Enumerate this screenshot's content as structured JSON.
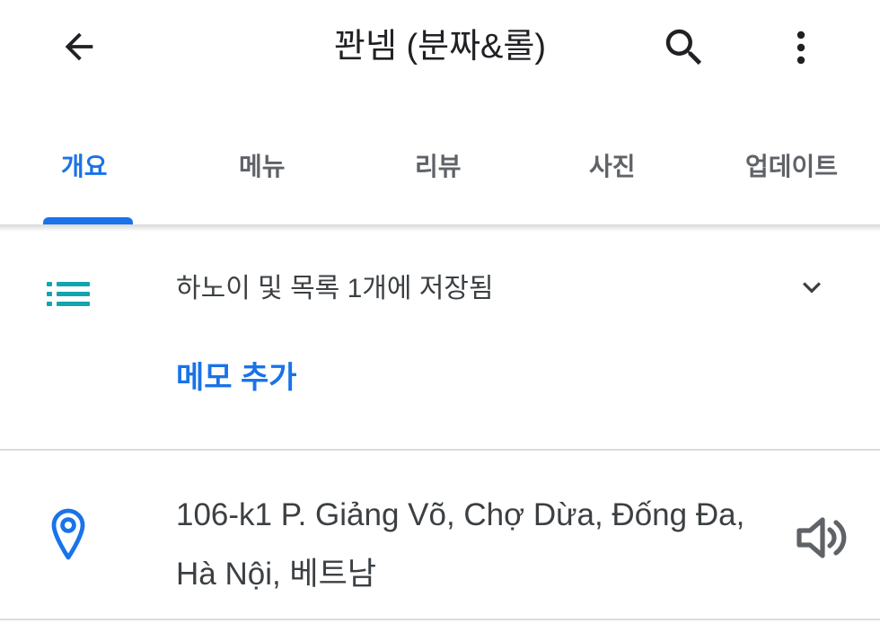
{
  "header": {
    "title": "꽌넴 (분짜&롤)",
    "back_icon": "arrow-back-icon",
    "search_icon": "search-icon",
    "more_icon": "more-vert-icon"
  },
  "tabs": [
    {
      "label": "개요",
      "active": true
    },
    {
      "label": "메뉴",
      "active": false
    },
    {
      "label": "리뷰",
      "active": false
    },
    {
      "label": "사진",
      "active": false
    },
    {
      "label": "업데이트",
      "active": false
    }
  ],
  "saved": {
    "text": "하노이 및 목록 1개에 저장됨",
    "icon": "list-icon",
    "expand_icon": "chevron-down-icon"
  },
  "memo": {
    "label": "메모 추가"
  },
  "address": {
    "text": "106-k1 P. Giảng Võ, Chợ Dừa, Đống Đa, Hà Nội, 베트남",
    "icon": "location-pin-icon",
    "action_icon": "speaker-icon"
  },
  "colors": {
    "accent": "#1a73e8",
    "list_icon": "#12a4af",
    "text_primary": "#202124",
    "text_secondary": "#5f6368",
    "divider": "#dadce0"
  }
}
